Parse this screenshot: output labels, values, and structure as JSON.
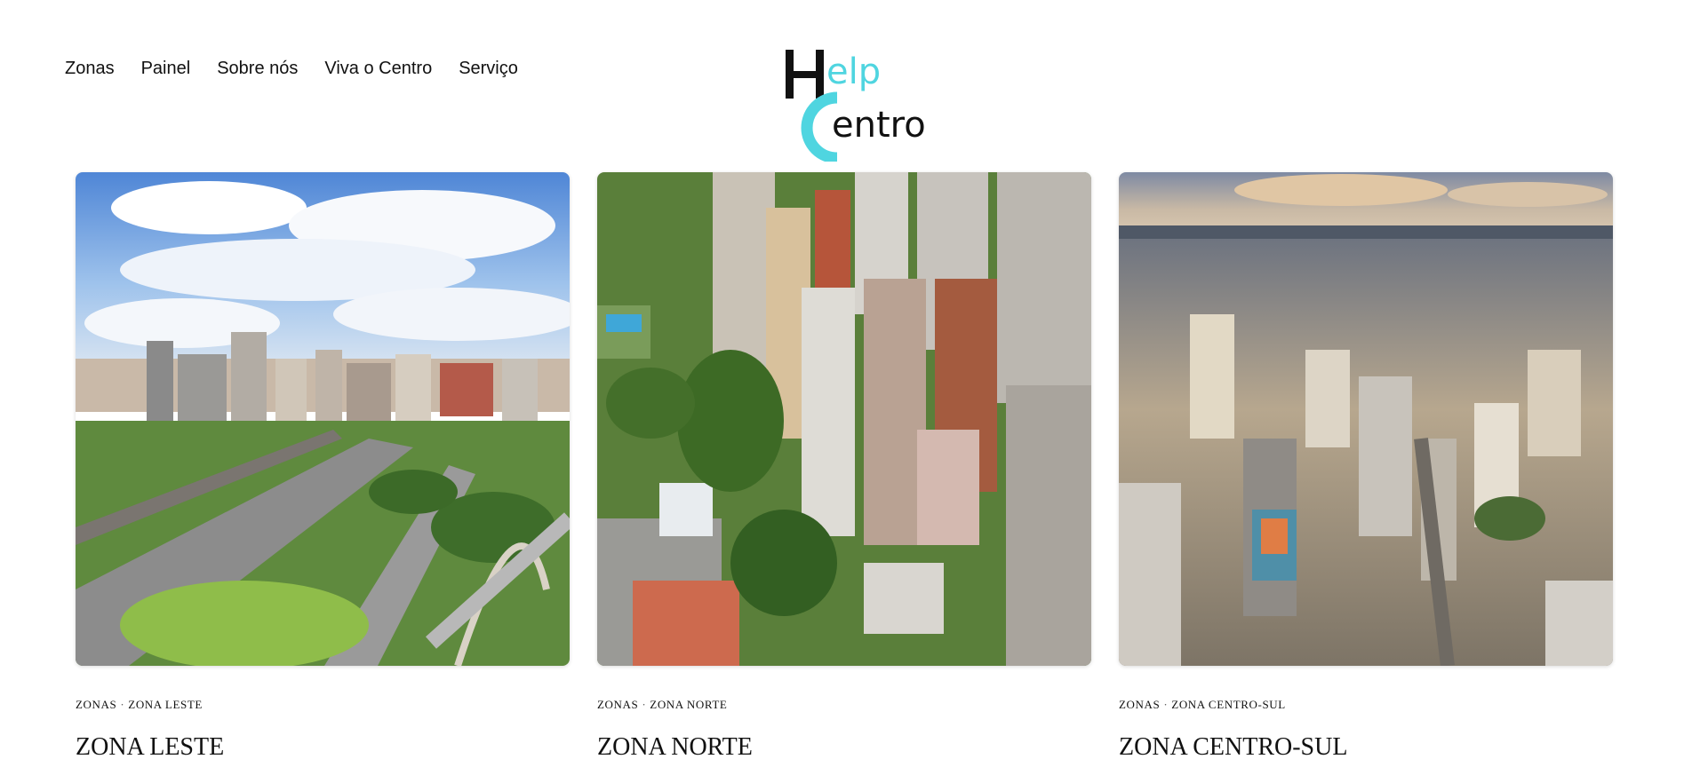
{
  "nav": {
    "items": [
      {
        "label": "Zonas"
      },
      {
        "label": "Painel"
      },
      {
        "label": "Sobre nós"
      },
      {
        "label": "Viva o Centro"
      },
      {
        "label": "Serviço"
      }
    ]
  },
  "logo": {
    "text": "Help Centro",
    "colors": {
      "dark": "#111111",
      "accent": "#4fd5e0"
    }
  },
  "cards": [
    {
      "category": "ZONAS",
      "subcategory": "ZONA LESTE",
      "separator": "·",
      "title": "ZONA LESTE",
      "image": "aerial-city-highway-photo"
    },
    {
      "category": "ZONAS",
      "subcategory": "ZONA NORTE",
      "separator": "·",
      "title": "ZONA NORTE",
      "image": "aerial-buildings-trees-photo"
    },
    {
      "category": "ZONAS",
      "subcategory": "ZONA CENTRO-SUL",
      "separator": "·",
      "title": "ZONA CENTRO-SUL",
      "image": "aerial-skyline-photo"
    }
  ]
}
